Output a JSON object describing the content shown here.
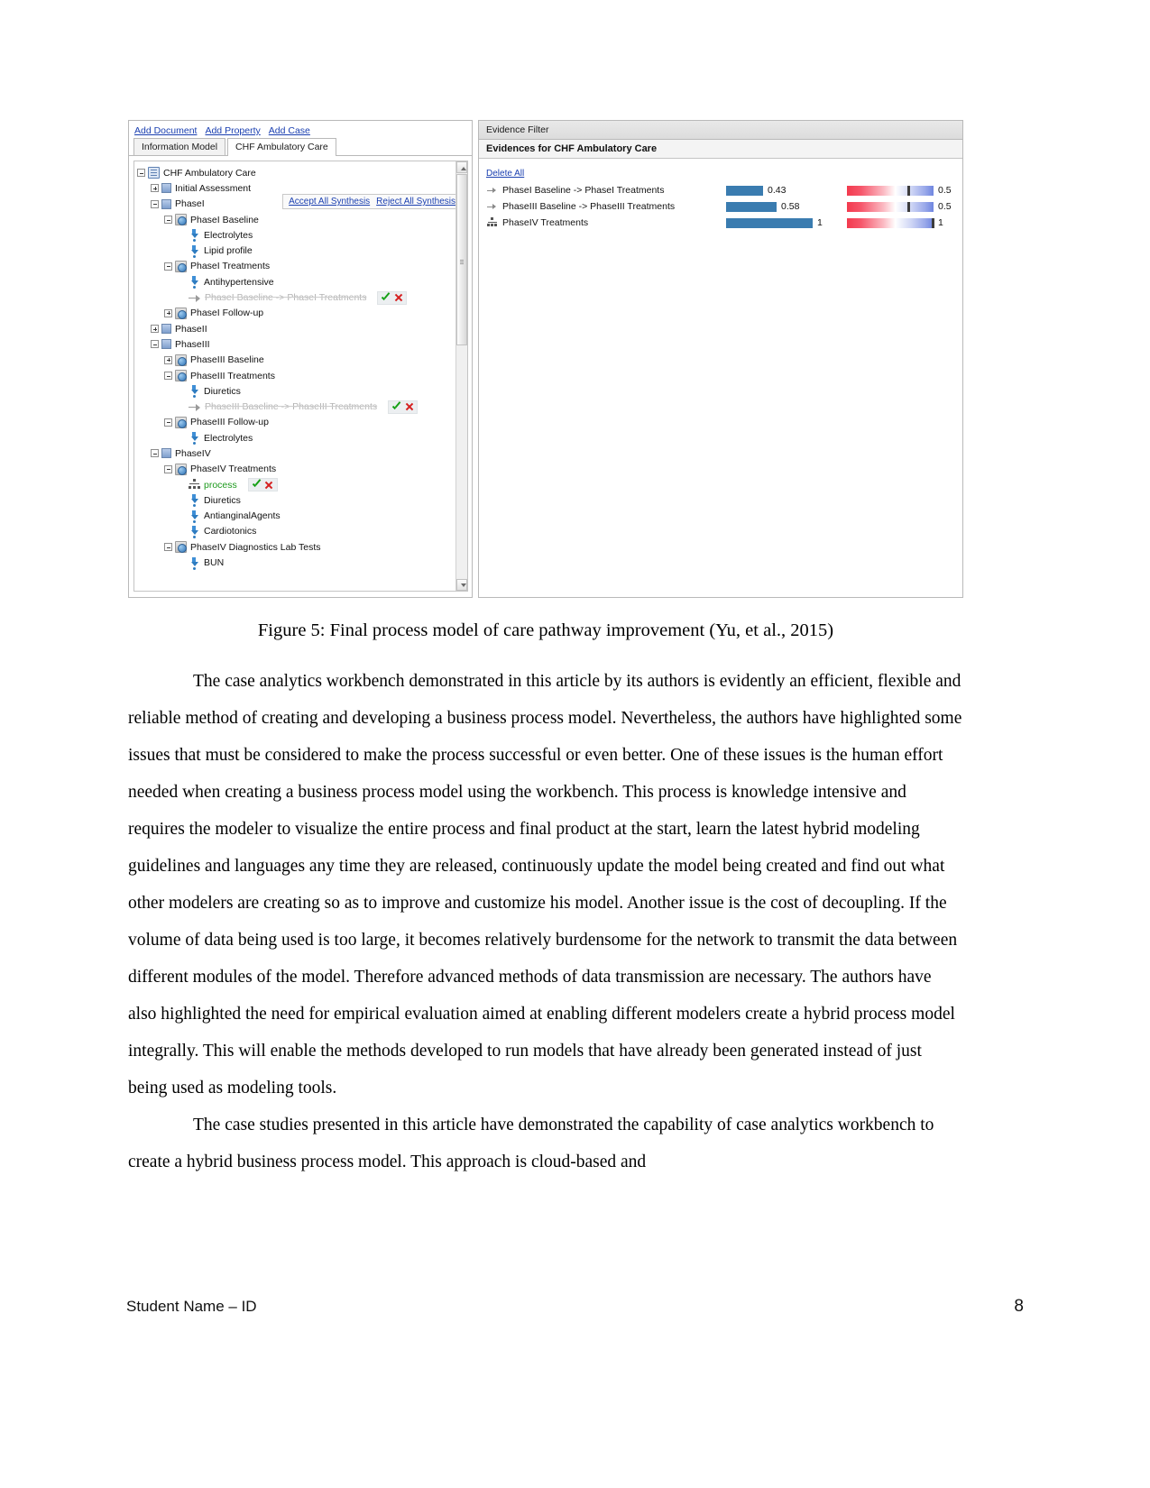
{
  "figure": {
    "left_panel": {
      "toolbar_links": [
        {
          "label": "Add Document",
          "name": "add-document-link"
        },
        {
          "label": "Add Property",
          "name": "add-property-link"
        },
        {
          "label": "Add Case",
          "name": "add-case-link"
        }
      ],
      "tabs": [
        {
          "label": "Information Model",
          "active": false
        },
        {
          "label": "CHF Ambulatory Care",
          "active": true
        }
      ],
      "synthesis_box": {
        "accept_label": "Accept All Synthesis",
        "reject_label": "Reject All Synthesis"
      },
      "tree": [
        {
          "label": "CHF Ambulatory Care",
          "depth": 0,
          "toggle": "minus",
          "icon": "document",
          "style": "normal",
          "actions": false
        },
        {
          "label": "Initial Assessment",
          "depth": 1,
          "toggle": "plus",
          "icon": "folder",
          "style": "normal",
          "actions": false
        },
        {
          "label": "PhaseI",
          "depth": 1,
          "toggle": "minus",
          "icon": "folder",
          "style": "normal",
          "actions": false
        },
        {
          "label": "PhaseI Baseline",
          "depth": 2,
          "toggle": "minus",
          "icon": "process",
          "style": "normal",
          "actions": false
        },
        {
          "label": "Electrolytes",
          "depth": 3,
          "toggle": "none",
          "icon": "attribute",
          "style": "normal",
          "actions": false
        },
        {
          "label": "Lipid profile",
          "depth": 3,
          "toggle": "none",
          "icon": "attribute",
          "style": "normal",
          "actions": false
        },
        {
          "label": "PhaseI Treatments",
          "depth": 2,
          "toggle": "minus",
          "icon": "process",
          "style": "normal",
          "actions": false
        },
        {
          "label": "Antihypertensive",
          "depth": 3,
          "toggle": "none",
          "icon": "attribute",
          "style": "normal",
          "actions": false
        },
        {
          "label": "PhaseI Baseline -> PhaseI Treatments",
          "depth": 3,
          "toggle": "none",
          "icon": "arrow",
          "style": "dim",
          "actions": true
        },
        {
          "label": "PhaseI Follow-up",
          "depth": 2,
          "toggle": "plus",
          "icon": "process",
          "style": "normal",
          "actions": false
        },
        {
          "label": "PhaseII",
          "depth": 1,
          "toggle": "plus",
          "icon": "folder",
          "style": "normal",
          "actions": false
        },
        {
          "label": "PhaseIII",
          "depth": 1,
          "toggle": "minus",
          "icon": "folder",
          "style": "normal",
          "actions": false
        },
        {
          "label": "PhaseIII Baseline",
          "depth": 2,
          "toggle": "plus",
          "icon": "process",
          "style": "normal",
          "actions": false
        },
        {
          "label": "PhaseIII Treatments",
          "depth": 2,
          "toggle": "minus",
          "icon": "process",
          "style": "normal",
          "actions": false
        },
        {
          "label": "Diuretics",
          "depth": 3,
          "toggle": "none",
          "icon": "attribute",
          "style": "normal",
          "actions": false
        },
        {
          "label": "PhaseIII Baseline -> PhaseIII Treatments",
          "depth": 3,
          "toggle": "none",
          "icon": "arrow",
          "style": "dim",
          "actions": true
        },
        {
          "label": "PhaseIII Follow-up",
          "depth": 2,
          "toggle": "minus",
          "icon": "process",
          "style": "normal",
          "actions": false
        },
        {
          "label": "Electrolytes",
          "depth": 3,
          "toggle": "none",
          "icon": "attribute",
          "style": "normal",
          "actions": false
        },
        {
          "label": "PhaseIV",
          "depth": 1,
          "toggle": "minus",
          "icon": "folder",
          "style": "normal",
          "actions": false
        },
        {
          "label": "PhaseIV Treatments",
          "depth": 2,
          "toggle": "minus",
          "icon": "process",
          "style": "normal",
          "actions": false
        },
        {
          "label": "process",
          "depth": 3,
          "toggle": "none",
          "icon": "network",
          "style": "green",
          "actions": true
        },
        {
          "label": "Diuretics",
          "depth": 3,
          "toggle": "none",
          "icon": "attribute",
          "style": "normal",
          "actions": false
        },
        {
          "label": "AntianginalAgents",
          "depth": 3,
          "toggle": "none",
          "icon": "attribute",
          "style": "normal",
          "actions": false
        },
        {
          "label": "Cardiotonics",
          "depth": 3,
          "toggle": "none",
          "icon": "attribute",
          "style": "normal",
          "actions": false
        },
        {
          "label": "PhaseIV Diagnostics Lab Tests",
          "depth": 2,
          "toggle": "minus",
          "icon": "process",
          "style": "normal",
          "actions": false
        },
        {
          "label": "BUN",
          "depth": 3,
          "toggle": "none",
          "icon": "attribute",
          "style": "normal",
          "actions": false
        }
      ]
    },
    "right_panel": {
      "title": "Evidence Filter",
      "subtitle": "Evidences for CHF Ambulatory Care",
      "delete_all_label": "Delete All",
      "evidences": [
        {
          "label": "PhaseI Baseline -> PhaseI Treatments",
          "icon": "link",
          "bar_value": "0.43",
          "bar_fraction": 0.43,
          "gradient_value": "0.5",
          "marker_fraction": 0.72
        },
        {
          "label": "PhaseIII Baseline -> PhaseIII Treatments",
          "icon": "link",
          "bar_value": "0.58",
          "bar_fraction": 0.58,
          "gradient_value": "0.5",
          "marker_fraction": 0.72
        },
        {
          "label": "PhaseIV Treatments",
          "icon": "network",
          "bar_value": "1",
          "bar_fraction": 1.0,
          "gradient_value": "1",
          "marker_fraction": 1.0
        }
      ]
    }
  },
  "caption": "Figure 5: Final process model of care pathway improvement (Yu, et al., 2015)",
  "paragraphs": [
    "The case analytics workbench demonstrated in this article by its authors is evidently an efficient, flexible and reliable method of creating and developing a business process model. Nevertheless, the authors have highlighted some issues that must be considered to make the process successful or even better. One of these issues is the human effort needed when creating a business process model using the workbench. This process is knowledge intensive and requires the modeler to visualize the entire process and final product at the start, learn the latest hybrid modeling guidelines and languages any time they are released, continuously update the model being created and find out what other modelers are creating so as to improve and customize his model. Another issue is the cost of decoupling. If the volume of data being used is too large, it becomes relatively burdensome for the network to transmit the data between different modules of the model. Therefore advanced methods of data transmission are necessary. The authors have also highlighted the need for empirical evaluation aimed at enabling different modelers create a hybrid process model integrally. This will enable the methods developed to run models that have already been generated instead of just being used as modeling tools.",
    "The case studies presented in this article have demonstrated the capability of case analytics workbench to create a hybrid business process model. This approach is cloud-based and"
  ],
  "footer": {
    "left": "Student Name – ID",
    "page_number": "8"
  }
}
